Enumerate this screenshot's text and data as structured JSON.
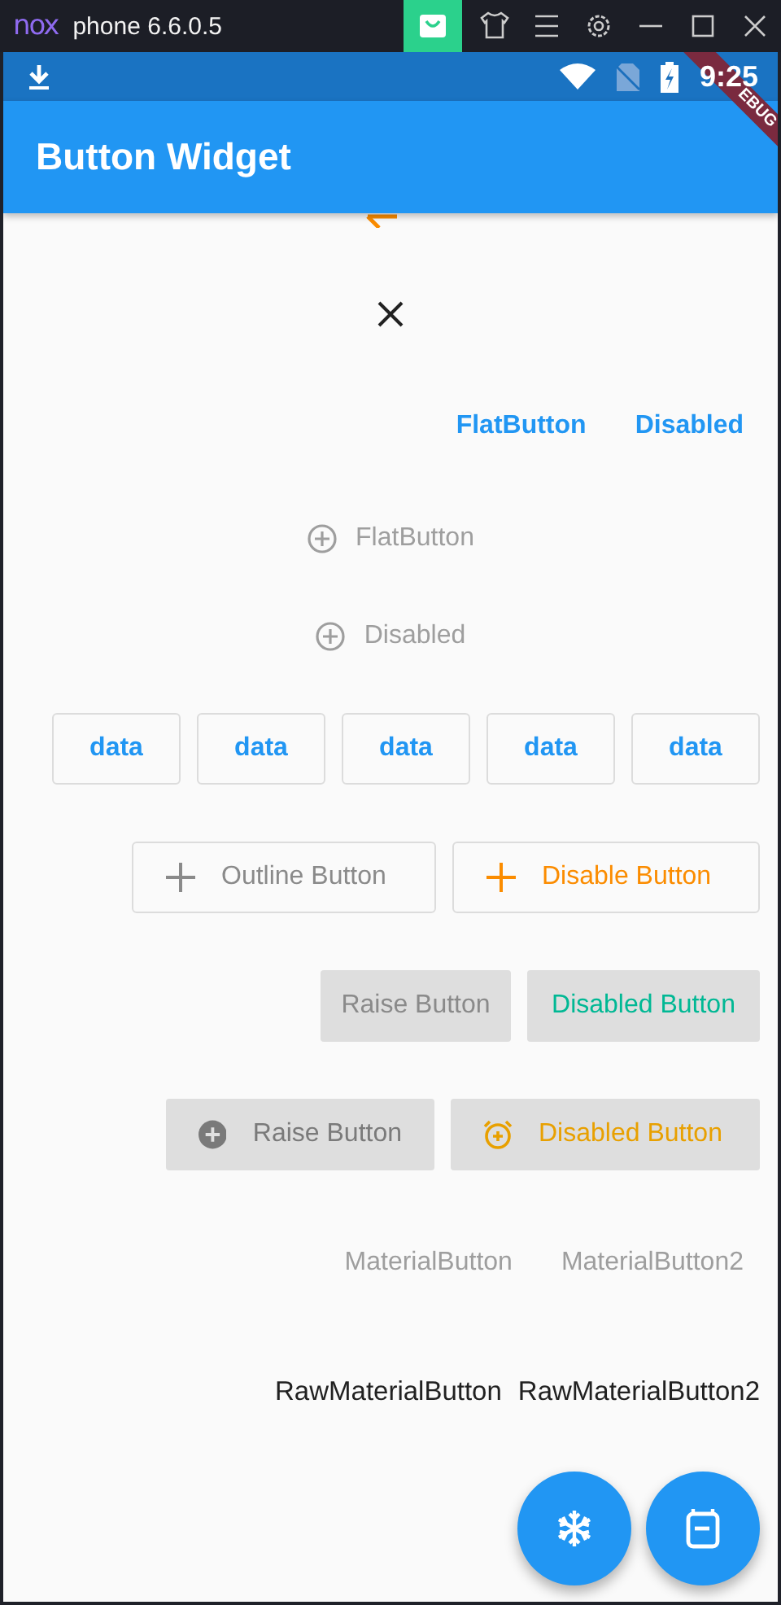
{
  "titlebar": {
    "logo": "nox",
    "title": "phone 6.6.0.5"
  },
  "status_bar": {
    "time": "9:25"
  },
  "debug_banner": "EBUG",
  "app_bar": {
    "title": "Button Widget"
  },
  "rows": [
    {
      "kind": "flat",
      "buttons": [
        {
          "label": "FlatButton",
          "color": "#2196f3"
        },
        {
          "label": "Disabled",
          "color": "#2196f3"
        }
      ]
    },
    {
      "kind": "flat-icon",
      "buttons": [
        {
          "label": "FlatButton",
          "color": "#9e9e9e"
        }
      ]
    },
    {
      "kind": "flat-icon",
      "buttons": [
        {
          "label": "Disabled",
          "color": "#9e9e9e"
        }
      ]
    },
    {
      "kind": "outline",
      "buttons": [
        {
          "label": "data",
          "color": "#2196f3"
        },
        {
          "label": "data",
          "color": "#2196f3"
        },
        {
          "label": "data",
          "color": "#2196f3"
        },
        {
          "label": "data",
          "color": "#2196f3"
        },
        {
          "label": "data",
          "color": "#2196f3"
        }
      ]
    },
    {
      "kind": "outline-icon",
      "buttons": [
        {
          "label": "Outline Button",
          "color": "#8a8a8a"
        },
        {
          "label": "Disable Button",
          "color": "#fb8c00"
        }
      ]
    },
    {
      "kind": "raised",
      "buttons": [
        {
          "label": "Raise Button",
          "color": "#8a8a8a"
        },
        {
          "label": "Disabled Button",
          "color": "#00b894"
        }
      ]
    },
    {
      "kind": "raised-icon",
      "buttons": [
        {
          "label": "Raise Button",
          "color": "#7a7a7a"
        },
        {
          "label": "Disabled Button",
          "color": "#e8a000"
        }
      ]
    },
    {
      "kind": "material",
      "buttons": [
        {
          "label": "MaterialButton",
          "color": "#9e9e9e"
        },
        {
          "label": "MaterialButton2",
          "color": "#9e9e9e"
        }
      ]
    },
    {
      "kind": "raw",
      "buttons": [
        {
          "label": "RawMaterialButton",
          "color": "#212121"
        },
        {
          "label": "RawMaterialButton2",
          "color": "#212121"
        }
      ]
    }
  ]
}
